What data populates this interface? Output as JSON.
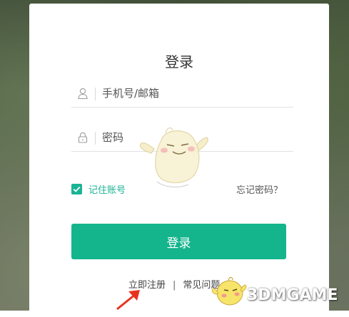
{
  "login": {
    "title": "登录",
    "account_placeholder": "手机号/邮箱",
    "password_placeholder": "密码",
    "remember_label": "记住账号",
    "remember_checked": true,
    "forgot_label": "忘记密码？",
    "submit_label": "登录",
    "register_label": "立即注册",
    "divider": "|",
    "faq_label": "常见问题"
  },
  "icons": {
    "account": "user-icon",
    "password": "lock-icon",
    "checkbox": "check-icon"
  },
  "colors": {
    "accent": "#14b48d",
    "remember_text": "#1ab394",
    "card": "#ffffff",
    "arrow": "#e8321e"
  },
  "watermark": {
    "text": "3DMGAME"
  }
}
